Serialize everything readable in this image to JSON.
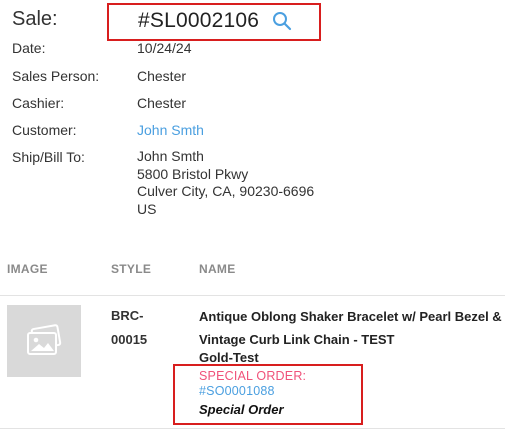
{
  "header": {
    "sale_label": "Sale:",
    "sale_number": "#SL0002106"
  },
  "info": {
    "date_label": "Date:",
    "date_value": "10/24/24",
    "sales_person_label": "Sales Person:",
    "sales_person_value": "Chester",
    "cashier_label": "Cashier:",
    "cashier_value": "Chester",
    "customer_label": "Customer:",
    "customer_value": "John Smth",
    "ship_bill_label": "Ship/Bill To:",
    "address": {
      "name": "John Smth",
      "street": "5800 Bristol Pkwy",
      "city": "Culver City, CA, 90230-6696",
      "country": "US"
    }
  },
  "table": {
    "headers": {
      "image": "IMAGE",
      "style": "STYLE",
      "name": "NAME"
    },
    "rows": [
      {
        "style_line1": "BRC-",
        "style_line2": "00015",
        "name_line1": "Antique Oblong Shaker Bracelet w/ Pearl Bezel &",
        "name_line2": "Vintage Curb Link Chain - TEST",
        "name_line3": "Gold-Test",
        "special_order_label": "SPECIAL ORDER:",
        "special_order_number": "#SO0001088",
        "special_order_status": "Special Order"
      }
    ]
  },
  "colors": {
    "link": "#4a9fe0",
    "special_label": "#f0527a",
    "highlight_box": "#d81e1e"
  },
  "icons": {
    "search": "search-icon",
    "thumbnail": "image-placeholder-icon"
  }
}
